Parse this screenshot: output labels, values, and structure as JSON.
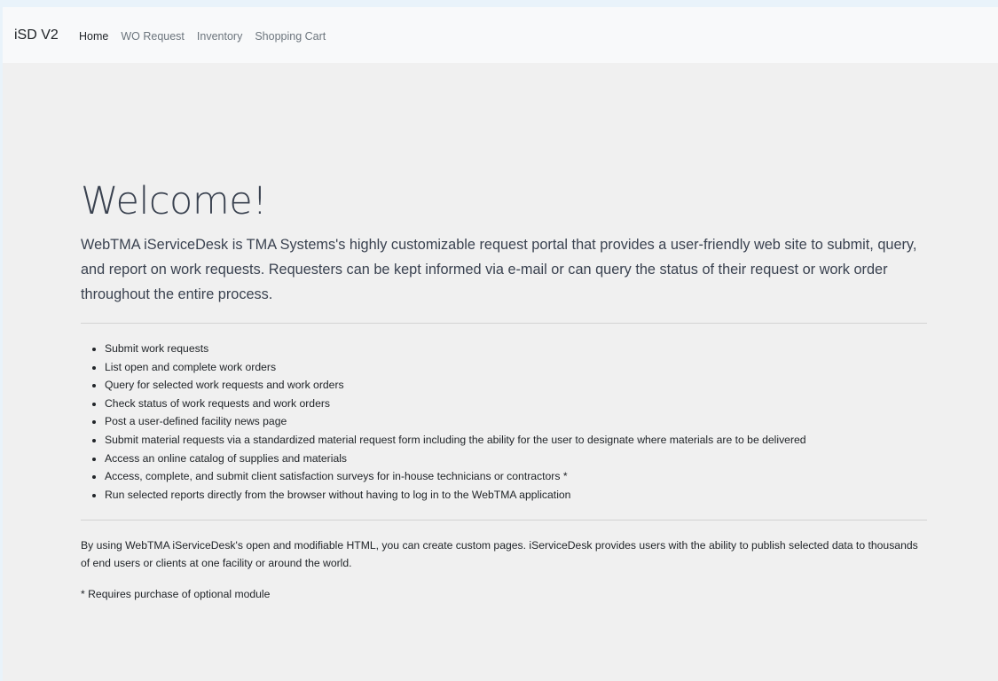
{
  "navbar": {
    "brand": "iSD V2",
    "links": [
      {
        "label": "Home",
        "active": true
      },
      {
        "label": "WO Request",
        "active": false
      },
      {
        "label": "Inventory",
        "active": false
      },
      {
        "label": "Shopping Cart",
        "active": false
      }
    ]
  },
  "main": {
    "title": "Welcome!",
    "lead": "WebTMA iServiceDesk is TMA Systems's highly customizable request portal that provides a user-friendly web site to submit, query, and report on work requests. Requesters can be kept informed via e-mail or can query the status of their request or work order throughout the entire process.",
    "features": [
      "Submit work requests",
      "List open and complete work orders",
      "Query for selected work requests and work orders",
      "Check status of work requests and work orders",
      "Post a user-defined facility news page",
      "Submit material requests via a standardized material request form including the ability for the user to designate where materials are to be delivered",
      "Access an online catalog of supplies and materials",
      "Access, complete, and submit client satisfaction surveys for in-house technicians or contractors *",
      "Run selected reports directly from the browser without having to log in to the WebTMA application"
    ],
    "paragraph": "By using WebTMA iServiceDesk's open and modifiable HTML, you can create custom pages. iServiceDesk provides users with the ability to publish selected data to thousands of end users or clients at one facility or around the world.",
    "footnote": "* Requires purchase of optional module"
  },
  "colors": {
    "navbar_bg": "#f8f9fa",
    "page_bg": "#f0f0f0",
    "outer_bg": "#e9f3fa",
    "heading": "#3a4250",
    "nav_inactive": "#6c757d"
  }
}
